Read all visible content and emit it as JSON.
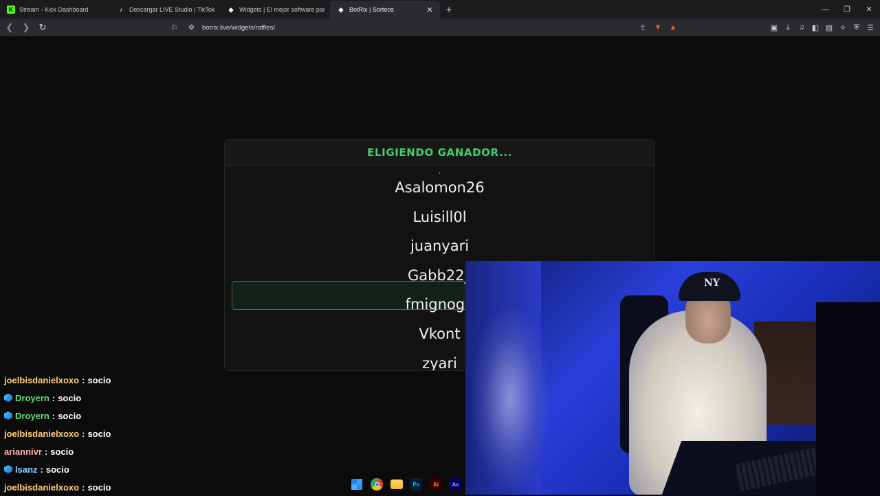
{
  "browser": {
    "tabs": [
      {
        "title": "Stream - Kick Dashboard",
        "icon": "kick-icon",
        "active": false
      },
      {
        "title": "Descargar LIVE Studio | TikTok",
        "icon": "tiktok-icon",
        "active": false
      },
      {
        "title": "Widgets | El mejor software para pot",
        "icon": "botrix-icon",
        "active": false
      },
      {
        "title": "BotRix | Sorteos",
        "icon": "botrix-icon",
        "active": true
      }
    ],
    "url": "botrix.live/widgets/raffles/",
    "new_tab_symbol": "+",
    "close_symbol": "✕",
    "window_controls": [
      "—",
      "❐",
      "✕"
    ]
  },
  "raffle": {
    "header": "ELIGIENDO GANADOR...",
    "names": [
      "Asalomon26",
      "Luisill0l",
      "juanyari",
      "Gabb22_",
      "fmignogn",
      "Vkont",
      "zyari"
    ],
    "highlighted_index": 3,
    "accent_color": "#3fd16b"
  },
  "chat": {
    "messages": [
      {
        "user": "joelbisdanielxoxo",
        "text": "socio",
        "badge": false,
        "color": "orange"
      },
      {
        "user": "Droyern",
        "text": "socio",
        "badge": true,
        "color": "green"
      },
      {
        "user": "Droyern",
        "text": "socio",
        "badge": true,
        "color": "green"
      },
      {
        "user": "joelbisdanielxoxo",
        "text": "socio",
        "badge": false,
        "color": "orange"
      },
      {
        "user": "ariannivr",
        "text": "socio",
        "badge": false,
        "color": "pink"
      },
      {
        "user": "lsanz",
        "text": "socio",
        "badge": true,
        "color": "blue"
      },
      {
        "user": "joelbisdanielxoxo",
        "text": "socio",
        "badge": false,
        "color": "orange"
      }
    ],
    "separator": ":"
  },
  "taskbar": {
    "apps": [
      {
        "label": "",
        "icon": "windows-start-icon"
      },
      {
        "label": "",
        "icon": "chrome-icon"
      },
      {
        "label": "",
        "icon": "file-explorer-icon"
      },
      {
        "label": "Ps",
        "icon": "photoshop-icon"
      },
      {
        "label": "Ai",
        "icon": "illustrator-icon"
      },
      {
        "label": "Ae",
        "icon": "after-effects-icon"
      }
    ]
  }
}
